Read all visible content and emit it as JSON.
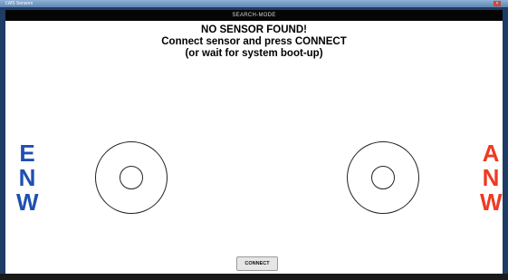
{
  "window": {
    "title": "LWS Sensors"
  },
  "mode_bar": {
    "label": "SEARCH-MODE"
  },
  "message": {
    "line1": "NO SENSOR FOUND!",
    "line2": "Connect sensor and press CONNECT",
    "line3": "(or wait for system boot-up)"
  },
  "left_sensor": {
    "letters": [
      "E",
      "N",
      "W"
    ],
    "color": "#1f4fb0"
  },
  "right_sensor": {
    "letters": [
      "A",
      "N",
      "W"
    ],
    "color": "#ef3a22"
  },
  "connect_button": {
    "label": "CONNECT"
  }
}
